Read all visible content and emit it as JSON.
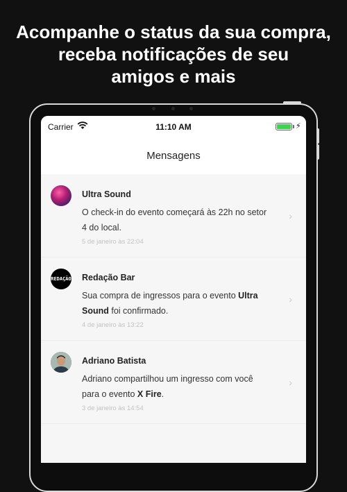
{
  "headline": {
    "line1": "Acompanhe o status da sua compra,",
    "line2": "receba notificações de seu",
    "line3": "amigos e mais"
  },
  "status_bar": {
    "carrier": "Carrier",
    "time": "11:10 AM",
    "battery_level": 1.0,
    "battery_color": "#3cd450"
  },
  "nav": {
    "title": "Mensagens"
  },
  "messages": [
    {
      "sender": "Ultra Sound",
      "text": "O check-in do evento começará às 22h no setor 4 do local.",
      "text_pre": "O check-in do evento começará às 22h no setor 4 do local.",
      "bold": "",
      "text_post": "",
      "date": "5 de janeiro às 22:04",
      "avatar_icon": "ultra-sound-avatar"
    },
    {
      "sender": "Redação Bar",
      "text_pre": "Sua compra de ingressos para o evento ",
      "bold": "Ultra Sound",
      "text_post": " foi confirmado.",
      "date": "4 de janeiro às 13:22",
      "avatar_icon": "redacao-bar-logo",
      "avatar_logo_text": "REDAÇÃO"
    },
    {
      "sender": "Adriano Batista",
      "text_pre": "Adriano compartilhou um ingresso com você para o evento ",
      "bold": "X Fire",
      "text_post": ".",
      "date": "3 de janeiro às 14:54",
      "avatar_icon": "adriano-photo"
    }
  ],
  "icons": {
    "wifi": "wifi-icon",
    "battery": "battery-icon",
    "charging": "charging-bolt-icon",
    "chevron": "chevron-right-icon",
    "chevron_glyph": "›",
    "bolt_glyph": "⚡"
  }
}
